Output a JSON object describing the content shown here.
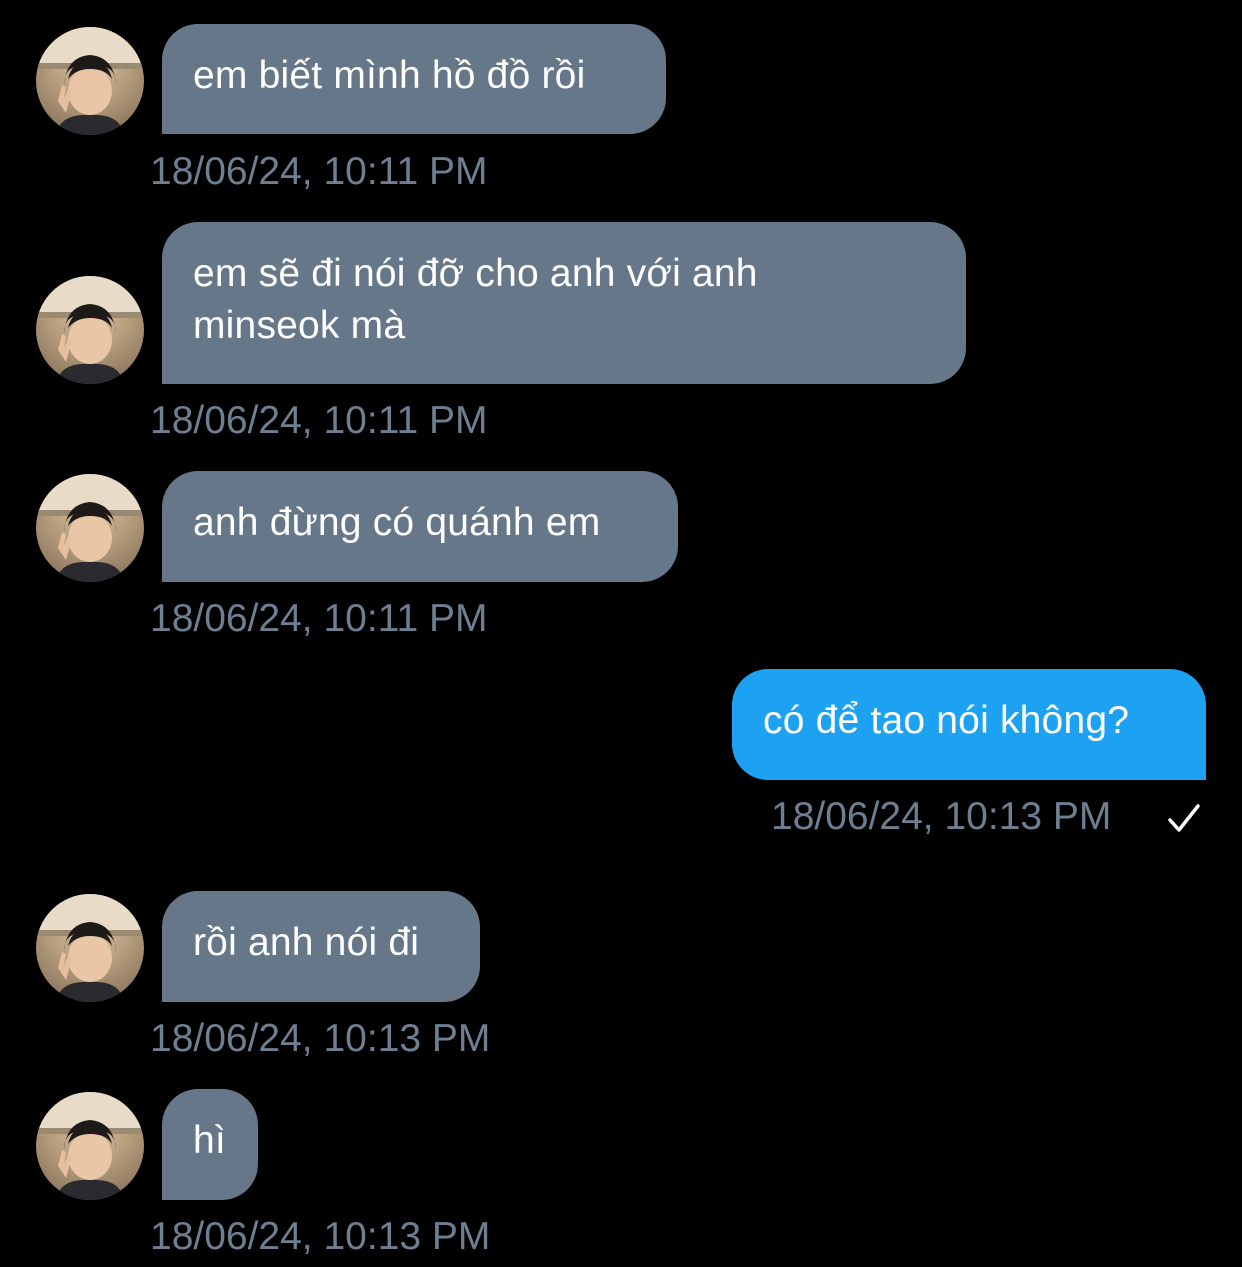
{
  "colors": {
    "background": "#000000",
    "incoming_bubble": "#66778a",
    "outgoing_bubble": "#1da1f2",
    "timestamp": "#6e7f92",
    "text": "#ffffff"
  },
  "messages": [
    {
      "direction": "incoming",
      "text": "em biết mình hồ đồ rồi",
      "time": "18/06/24, 10:11 PM"
    },
    {
      "direction": "incoming",
      "text": "em sẽ đi nói đỡ cho anh với anh",
      "text_line2": "minseok mà",
      "time": "18/06/24, 10:11 PM"
    },
    {
      "direction": "incoming",
      "text": "anh đừng có quánh em",
      "time": "18/06/24, 10:11 PM"
    },
    {
      "direction": "outgoing",
      "text": "có để tao nói không?",
      "time": "18/06/24, 10:13 PM",
      "status_icon": "checkmark-icon"
    },
    {
      "direction": "incoming",
      "text": "rồi anh nói đi",
      "time": "18/06/24, 10:13 PM"
    },
    {
      "direction": "incoming",
      "text": "hì",
      "time": "18/06/24, 10:13 PM"
    }
  ]
}
